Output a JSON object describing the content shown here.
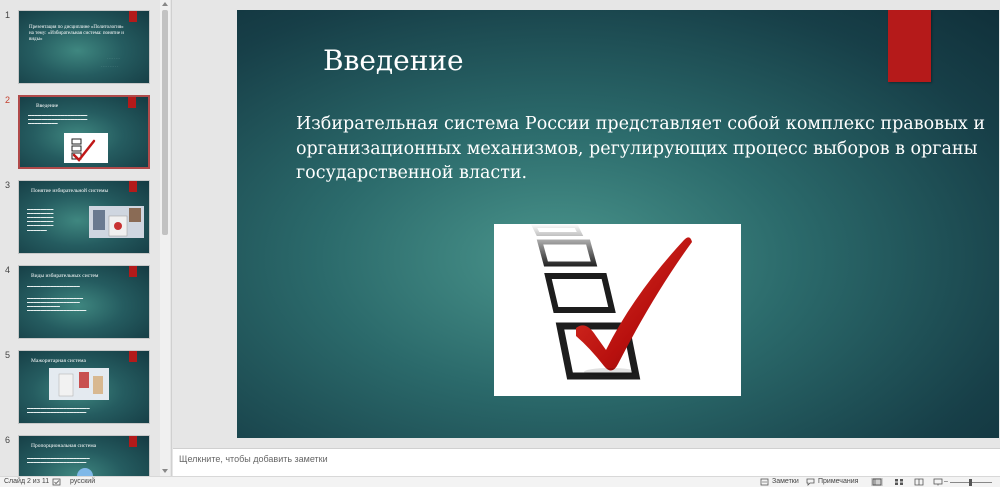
{
  "thumbnails": [
    {
      "number": "1",
      "title": "Презентация по дисциплине «Политология» на тему: «Избирательная система: понятие и виды»",
      "active": false
    },
    {
      "number": "2",
      "title": "Введение",
      "active": true
    },
    {
      "number": "3",
      "title": "Понятие избирательной системы",
      "active": false
    },
    {
      "number": "4",
      "title": "Виды избирательных систем",
      "active": false
    },
    {
      "number": "5",
      "title": "Мажоритарная система",
      "active": false
    },
    {
      "number": "6",
      "title": "Пропорциональная система",
      "active": false
    }
  ],
  "slide": {
    "title": "Введение",
    "body": "Избирательная система России представляет собой комплекс правовых и организационных механизмов, регулирующих процесс выборов в органы государственной власти.",
    "image_icon": "checkbox-checkmark-image"
  },
  "notes": {
    "placeholder": "Щелкните, чтобы добавить заметки"
  },
  "status_bar": {
    "slide_counter": "Слайд 2 из 11",
    "language": "русский",
    "notes_label": "Заметки",
    "comments_label": "Примечания",
    "zoom_percent": 45
  },
  "colors": {
    "accent_red": "#b51a1a",
    "slide_teal": "#2b6a6b",
    "active_thumb_border": "#b04a4a"
  }
}
